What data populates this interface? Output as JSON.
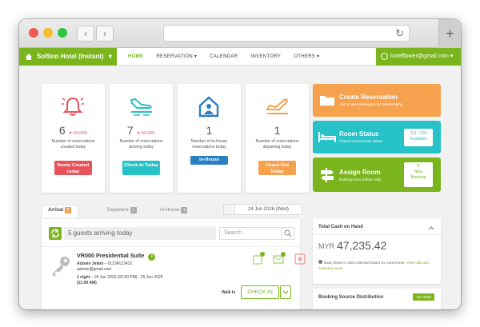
{
  "nav": {
    "brand": "Softinn Hotel (Instant)",
    "brand_caret": "▾",
    "items": [
      {
        "label": "HOME",
        "active": true
      },
      {
        "label": "RESERVATION ▾"
      },
      {
        "label": "CALENDAR"
      },
      {
        "label": "INVENTORY"
      },
      {
        "label": "OTHERS ▾"
      }
    ],
    "user_email": "hotelflower@gmail.com ▾"
  },
  "cards": [
    {
      "count": "6",
      "delta": "▼-90.00%",
      "desc": "Number of reservations created today",
      "button": "Newly Created today",
      "color": "#e8525a"
    },
    {
      "count": "7",
      "delta": "▼-90.00%",
      "desc": "Number of reservations arriving today",
      "button": "Check-In Today",
      "color": "#26c2c7"
    },
    {
      "count": "1",
      "delta": "",
      "desc": "Number of in-house reservations today",
      "button": "In-House",
      "color": "#2a7fc1"
    },
    {
      "count": "1",
      "delta": "",
      "desc": "Number of reservations departing today",
      "button": "Check-Out Today",
      "color": "#f5a14d"
    }
  ],
  "actions": {
    "create": {
      "title": "Create Reservation",
      "subtitle": "Add a new reservation for new booking",
      "color": "#f5a14d"
    },
    "room_status": {
      "title": "Room Status",
      "subtitle": "Check current room status",
      "box_line1": "111 / 118",
      "box_line2": "Available",
      "color": "#26c2c7"
    },
    "assign": {
      "title": "Assign Room",
      "subtitle": "Booking from Softinn only",
      "box_line1": "0",
      "box_line2": "New",
      "box_line3": "Booking",
      "color": "#7ab51d"
    }
  },
  "tabs": [
    {
      "label": "Arrival",
      "count": "7"
    },
    {
      "label": "Departure",
      "count": "1"
    },
    {
      "label": "In-House",
      "count": "1"
    }
  ],
  "date_display": "24 Jun 2026  (Wed)",
  "list": {
    "filter_text": "5 guests arriving today",
    "search_placeholder": "Search",
    "reservation": {
      "title": "VR000 Presidential Suite",
      "guest": "Adzwin Jelani",
      "phone": "– 01234123412",
      "email": "adzwin@gmail.com",
      "nights": "1 night",
      "stay": "– 24 Jun 2026 (02:00 PM) - 25 Jun 2026",
      "time": "(11:00 AM)",
      "walkin": "Walk In",
      "checkin": "CHECK IN"
    }
  },
  "cash": {
    "title": "Total Cash on Hand",
    "currency": "MYR",
    "amount": "47,235.42",
    "note": "Data shown is cash collected based on current time.",
    "link": "View collection summary report."
  },
  "booking_source": {
    "title": "Booking Source Distribution",
    "badge": "Jun 2026"
  },
  "colors": {
    "brand": "#7ab51d"
  }
}
